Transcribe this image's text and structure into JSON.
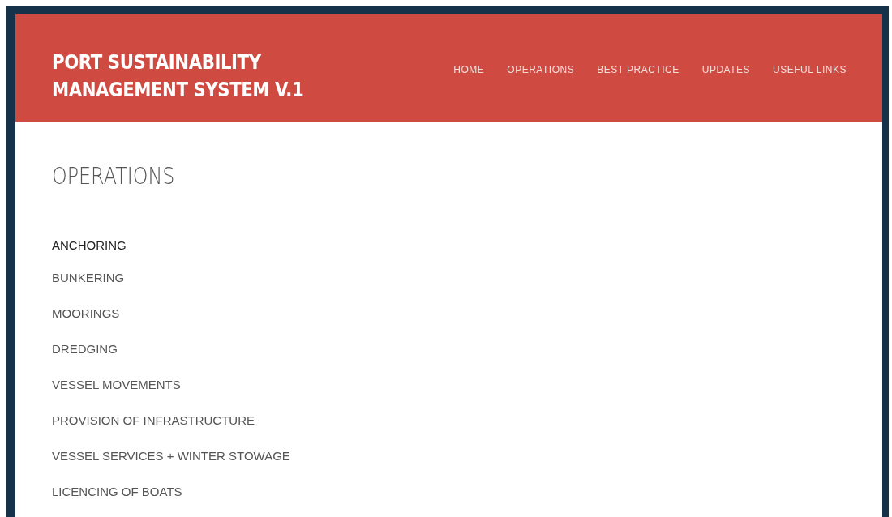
{
  "header": {
    "title_lines": [
      "PORT SUSTAINABILITY",
      "MANAGEMENT SYSTEM V.1"
    ]
  },
  "nav": [
    {
      "label": "HOME",
      "selected": false
    },
    {
      "label": "OPERATIONS",
      "selected": false
    },
    {
      "label": "BEST PRACTICE",
      "selected": false
    },
    {
      "label": "UPDATES",
      "selected": false
    },
    {
      "label": "USEFUL LINKS",
      "selected": false
    }
  ],
  "page_title": "OPERATIONS",
  "operations": [
    {
      "label": "ANCHORING",
      "selected": true
    },
    {
      "label": "BUNKERING",
      "selected": false
    },
    {
      "label": "MOORINGS",
      "selected": false
    },
    {
      "label": "DREDGING",
      "selected": false
    },
    {
      "label": "VESSEL MOVEMENTS",
      "selected": false
    },
    {
      "label": "PROVISION OF INFRASTRUCTURE",
      "selected": false
    },
    {
      "label": "VESSEL SERVICES + WINTER STOWAGE",
      "selected": false
    },
    {
      "label": "LICENCING OF BOATS",
      "selected": false
    }
  ]
}
